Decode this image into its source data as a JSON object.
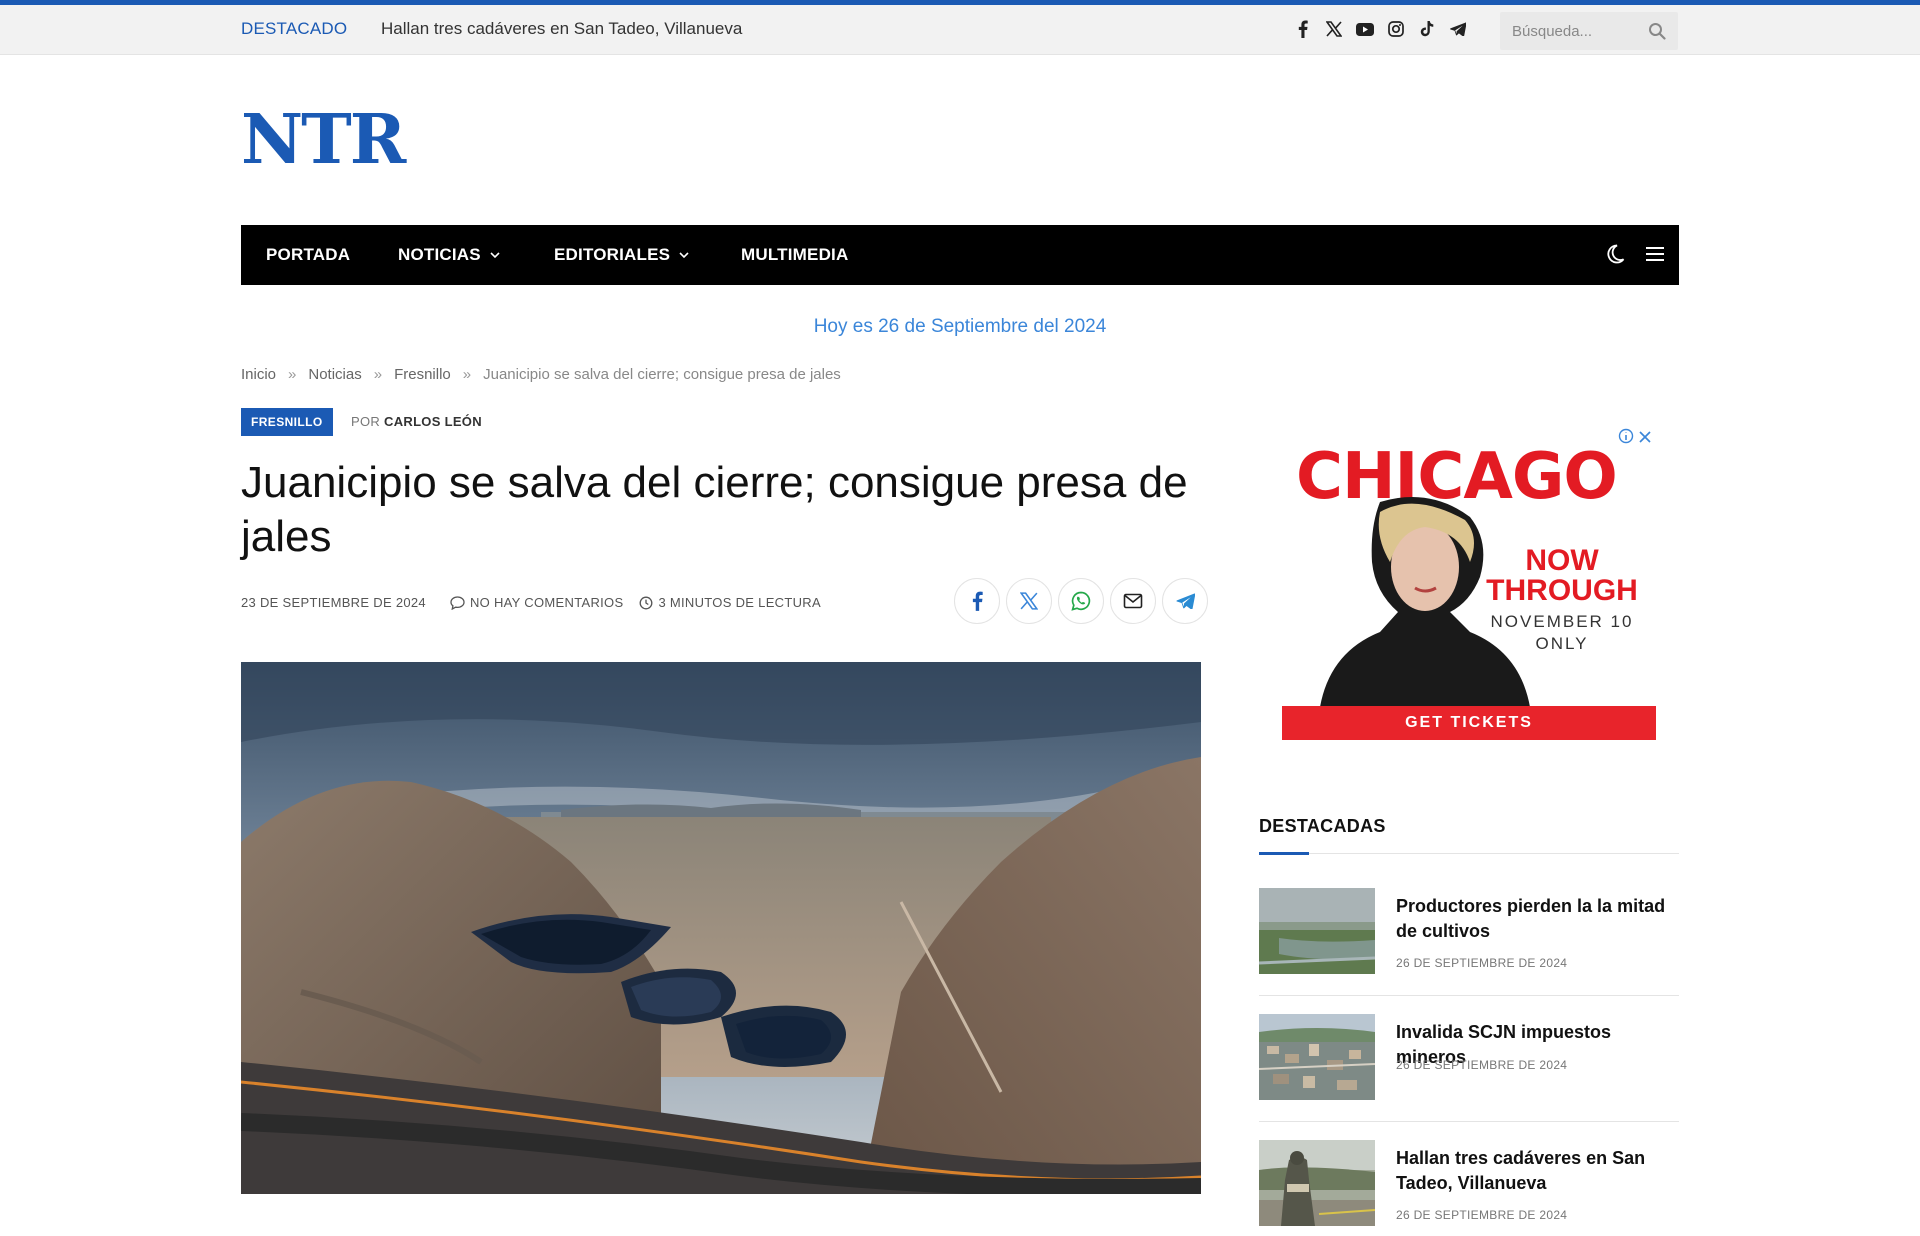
{
  "colors": {
    "brand": "#1b5ab4",
    "accent_link": "#3b86d9",
    "nav_bg": "#000000",
    "ad_red": "#e31b23"
  },
  "topbar": {
    "featured_label": "DESTACADO",
    "featured_title": "Hallan tres cadáveres en San Tadeo, Villanueva",
    "social_icons": [
      "facebook-icon",
      "x-icon",
      "youtube-icon",
      "instagram-icon",
      "tiktok-icon",
      "telegram-icon"
    ],
    "search_placeholder": "Búsqueda..."
  },
  "logo": "NTR",
  "nav": {
    "items": [
      {
        "label": "PORTADA",
        "dropdown": false
      },
      {
        "label": "NOTICIAS",
        "dropdown": true
      },
      {
        "label": "EDITORIALES",
        "dropdown": true
      },
      {
        "label": "MULTIMEDIA",
        "dropdown": false
      }
    ],
    "right_icons": [
      "dark-mode-icon",
      "menu-icon"
    ]
  },
  "today": "Hoy es 26 de Septiembre del 2024",
  "breadcrumb": [
    "Inicio",
    "Noticias",
    "Fresnillo",
    "Juanicipio se salva del cierre; consigue presa de jales"
  ],
  "breadcrumb_separator": "»",
  "article": {
    "category": "FRESNILLO",
    "by_prefix": "POR",
    "author": "CARLOS LEÓN",
    "title": "Juanicipio se salva del cierre; consigue presa de jales",
    "date": "23 DE SEPTIEMBRE DE 2024",
    "comments": "NO HAY COMENTARIOS",
    "read_time": "3 MINUTOS DE LECTURA",
    "share_icons": [
      "facebook-icon",
      "x-icon",
      "whatsapp-icon",
      "email-icon",
      "telegram-icon"
    ]
  },
  "ad": {
    "title": "CHICAGO",
    "now_line1": "NOW",
    "now_line2": "THROUGH",
    "date_line1": "NOVEMBER 10",
    "date_line2": "ONLY",
    "cta": "GET TICKETS",
    "badge_icons": [
      "adchoices-icon",
      "close-icon"
    ]
  },
  "sidebar": {
    "heading": "DESTACADAS",
    "items": [
      {
        "title": "Productores pierden la la mitad de cultivos",
        "date": "26 DE SEPTIEMBRE DE 2024"
      },
      {
        "title": "Invalida SCJN impuestos mineros",
        "date": "26 DE SEPTIEMBRE DE 2024"
      },
      {
        "title": "Hallan tres cadáveres en San Tadeo, Villanueva",
        "date": "26 DE SEPTIEMBRE DE 2024"
      }
    ]
  }
}
